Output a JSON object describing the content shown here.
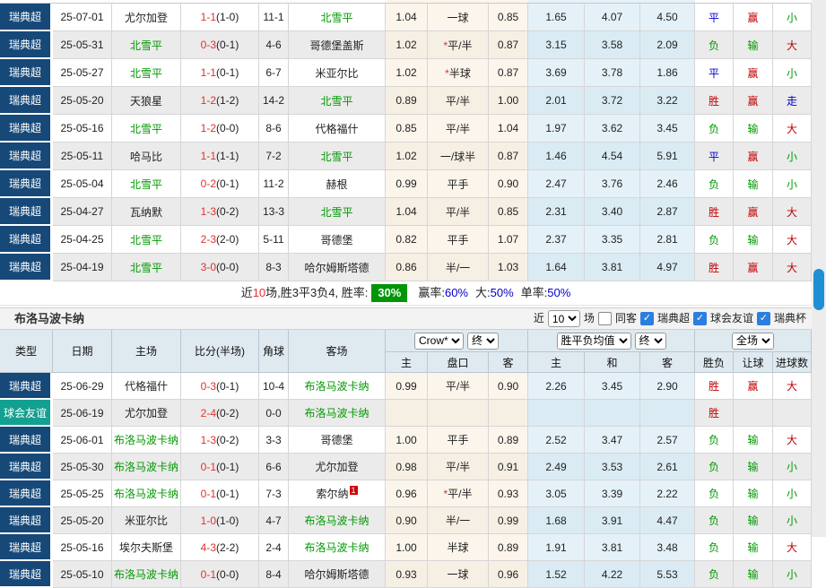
{
  "colors": {
    "league_navy": "#164878",
    "friendly_teal": "#14a091",
    "score_red": "#e03131",
    "word_red": "#c00000",
    "word_green": "#009900",
    "word_blue": "#0000cb",
    "asian_bg": "#fbf5ec",
    "euro_bg": "#e4f1f8",
    "alt_row": "#ebebeb",
    "summary_box_green": "#009608",
    "checkbox_blue": "#2b7fe0",
    "scroll_thumb": "#1f8fd6"
  },
  "icons": {
    "checkmark": "✓"
  },
  "table1": {
    "rows": [
      {
        "lg": "瑞典超",
        "date": "25-07-01",
        "home": "尤尔加登",
        "hg": false,
        "score": "1-1",
        "half": "(1-0)",
        "corner": "11-1",
        "away": "北雪平",
        "ag": true,
        "a1": "1.04",
        "star": false,
        "line": "一球",
        "a2": "0.85",
        "e1": "1.65",
        "e2": "4.07",
        "e3": "4.50",
        "r": "平",
        "rc": "blue",
        "h": "赢",
        "hc": "red",
        "g": "小",
        "gc": "green"
      },
      {
        "lg": "瑞典超",
        "date": "25-05-31",
        "home": "北雪平",
        "hg": true,
        "score": "0-3",
        "half": "(0-1)",
        "corner": "4-6",
        "away": "哥德堡盖斯",
        "ag": false,
        "a1": "1.02",
        "star": true,
        "line": "平/半",
        "a2": "0.87",
        "e1": "3.15",
        "e2": "3.58",
        "e3": "2.09",
        "r": "负",
        "rc": "green",
        "h": "输",
        "hc": "green",
        "g": "大",
        "gc": "red"
      },
      {
        "lg": "瑞典超",
        "date": "25-05-27",
        "home": "北雪平",
        "hg": true,
        "score": "1-1",
        "half": "(0-1)",
        "corner": "6-7",
        "away": "米亚尔比",
        "ag": false,
        "a1": "1.02",
        "star": true,
        "line": "半球",
        "a2": "0.87",
        "e1": "3.69",
        "e2": "3.78",
        "e3": "1.86",
        "r": "平",
        "rc": "blue",
        "h": "赢",
        "hc": "red",
        "g": "小",
        "gc": "green"
      },
      {
        "lg": "瑞典超",
        "date": "25-05-20",
        "home": "天狼星",
        "hg": false,
        "score": "1-2",
        "half": "(1-2)",
        "corner": "14-2",
        "away": "北雪平",
        "ag": true,
        "a1": "0.89",
        "star": false,
        "line": "平/半",
        "a2": "1.00",
        "e1": "2.01",
        "e2": "3.72",
        "e3": "3.22",
        "r": "胜",
        "rc": "red",
        "h": "赢",
        "hc": "red",
        "g": "走",
        "gc": "blue"
      },
      {
        "lg": "瑞典超",
        "date": "25-05-16",
        "home": "北雪平",
        "hg": true,
        "score": "1-2",
        "half": "(0-0)",
        "corner": "8-6",
        "away": "代格福什",
        "ag": false,
        "a1": "0.85",
        "star": false,
        "line": "平/半",
        "a2": "1.04",
        "e1": "1.97",
        "e2": "3.62",
        "e3": "3.45",
        "r": "负",
        "rc": "green",
        "h": "输",
        "hc": "green",
        "g": "大",
        "gc": "red"
      },
      {
        "lg": "瑞典超",
        "date": "25-05-11",
        "home": "哈马比",
        "hg": false,
        "score": "1-1",
        "half": "(1-1)",
        "corner": "7-2",
        "away": "北雪平",
        "ag": true,
        "a1": "1.02",
        "star": false,
        "line": "一/球半",
        "a2": "0.87",
        "e1": "1.46",
        "e2": "4.54",
        "e3": "5.91",
        "r": "平",
        "rc": "blue",
        "h": "赢",
        "hc": "red",
        "g": "小",
        "gc": "green"
      },
      {
        "lg": "瑞典超",
        "date": "25-05-04",
        "home": "北雪平",
        "hg": true,
        "score": "0-2",
        "half": "(0-1)",
        "corner": "11-2",
        "away": "赫根",
        "ag": false,
        "a1": "0.99",
        "star": false,
        "line": "平手",
        "a2": "0.90",
        "e1": "2.47",
        "e2": "3.76",
        "e3": "2.46",
        "r": "负",
        "rc": "green",
        "h": "输",
        "hc": "green",
        "g": "小",
        "gc": "green"
      },
      {
        "lg": "瑞典超",
        "date": "25-04-27",
        "home": "瓦纳默",
        "hg": false,
        "score": "1-3",
        "half": "(0-2)",
        "corner": "13-3",
        "away": "北雪平",
        "ag": true,
        "a1": "1.04",
        "star": false,
        "line": "平/半",
        "a2": "0.85",
        "e1": "2.31",
        "e2": "3.40",
        "e3": "2.87",
        "r": "胜",
        "rc": "red",
        "h": "赢",
        "hc": "red",
        "g": "大",
        "gc": "red"
      },
      {
        "lg": "瑞典超",
        "date": "25-04-25",
        "home": "北雪平",
        "hg": true,
        "score": "2-3",
        "half": "(2-0)",
        "corner": "5-11",
        "away": "哥德堡",
        "ag": false,
        "a1": "0.82",
        "star": false,
        "line": "平手",
        "a2": "1.07",
        "e1": "2.37",
        "e2": "3.35",
        "e3": "2.81",
        "r": "负",
        "rc": "green",
        "h": "输",
        "hc": "green",
        "g": "大",
        "gc": "red"
      },
      {
        "lg": "瑞典超",
        "date": "25-04-19",
        "home": "北雪平",
        "hg": true,
        "score": "3-0",
        "half": "(0-0)",
        "corner": "8-3",
        "away": "哈尔姆斯塔德",
        "ag": false,
        "a1": "0.86",
        "star": false,
        "line": "半/一",
        "a2": "1.03",
        "e1": "1.64",
        "e2": "3.81",
        "e3": "4.97",
        "r": "胜",
        "rc": "red",
        "h": "赢",
        "hc": "red",
        "g": "大",
        "gc": "red"
      }
    ],
    "summary": {
      "t1": "近",
      "t2": "10",
      "t3": "场,胜3平3负4, 胜率:",
      "box": "30%",
      "parts": [
        {
          "label": "赢率:",
          "value": "60%"
        },
        {
          "label": "大:",
          "value": "50%"
        },
        {
          "label": "单率:",
          "value": "50%"
        }
      ]
    }
  },
  "table2": {
    "title": "布洛马波卡纳",
    "controls": {
      "recent_label": "近",
      "recent_value": "10",
      "matches_label": "场",
      "same_venue_label": "同客",
      "leagues": [
        {
          "label": "瑞典超",
          "checked": true
        },
        {
          "label": "球会友谊",
          "checked": true
        },
        {
          "label": "瑞典杯",
          "checked": true
        }
      ]
    },
    "header": {
      "cols": [
        "类型",
        "日期",
        "主场",
        "比分(半场)",
        "角球",
        "客场"
      ],
      "sub": [
        "主",
        "盘口",
        "客",
        "主",
        "和",
        "客",
        "胜负",
        "让球",
        "进球数"
      ],
      "selects": {
        "crow": "Crow*",
        "final1": "终",
        "avg": "胜平负均值",
        "final2": "终",
        "scope": "全场"
      }
    },
    "rows": [
      {
        "lg": "瑞典超",
        "teal": false,
        "date": "25-06-29",
        "home": "代格福什",
        "hg": false,
        "score": "0-3",
        "half": "(0-1)",
        "corner": "10-4",
        "away": "布洛马波卡纳",
        "ag": true,
        "a1": "0.99",
        "star": false,
        "line": "平/半",
        "a2": "0.90",
        "e1": "2.26",
        "e2": "3.45",
        "e3": "2.90",
        "r": "胜",
        "rc": "red",
        "h": "赢",
        "hc": "red",
        "g": "大",
        "gc": "red"
      },
      {
        "lg": "球会友谊",
        "teal": true,
        "date": "25-06-19",
        "home": "尤尔加登",
        "hg": false,
        "score": "2-4",
        "half": "(0-2)",
        "corner": "0-0",
        "away": "布洛马波卡纳",
        "ag": true,
        "a1": "",
        "star": false,
        "line": "",
        "a2": "",
        "e1": "",
        "e2": "",
        "e3": "",
        "r": "胜",
        "rc": "red",
        "h": "",
        "hc": "red",
        "g": "",
        "gc": "red"
      },
      {
        "lg": "瑞典超",
        "teal": false,
        "date": "25-06-01",
        "home": "布洛马波卡纳",
        "hg": true,
        "score": "1-3",
        "half": "(0-2)",
        "corner": "3-3",
        "away": "哥德堡",
        "ag": false,
        "a1": "1.00",
        "star": false,
        "line": "平手",
        "a2": "0.89",
        "e1": "2.52",
        "e2": "3.47",
        "e3": "2.57",
        "r": "负",
        "rc": "green",
        "h": "输",
        "hc": "green",
        "g": "大",
        "gc": "red"
      },
      {
        "lg": "瑞典超",
        "teal": false,
        "date": "25-05-30",
        "home": "布洛马波卡纳",
        "hg": true,
        "score": "0-1",
        "half": "(0-1)",
        "corner": "6-6",
        "away": "尤尔加登",
        "ag": false,
        "a1": "0.98",
        "star": false,
        "line": "平/半",
        "a2": "0.91",
        "e1": "2.49",
        "e2": "3.53",
        "e3": "2.61",
        "r": "负",
        "rc": "green",
        "h": "输",
        "hc": "green",
        "g": "小",
        "gc": "green"
      },
      {
        "lg": "瑞典超",
        "teal": false,
        "date": "25-05-25",
        "home": "布洛马波卡纳",
        "hg": true,
        "score": "0-1",
        "half": "(0-1)",
        "corner": "7-3",
        "away": "索尔纳",
        "ag": false,
        "card": "1",
        "a1": "0.96",
        "star": true,
        "line": "平/半",
        "a2": "0.93",
        "e1": "3.05",
        "e2": "3.39",
        "e3": "2.22",
        "r": "负",
        "rc": "green",
        "h": "输",
        "hc": "green",
        "g": "小",
        "gc": "green"
      },
      {
        "lg": "瑞典超",
        "teal": false,
        "date": "25-05-20",
        "home": "米亚尔比",
        "hg": false,
        "score": "1-0",
        "half": "(1-0)",
        "corner": "4-7",
        "away": "布洛马波卡纳",
        "ag": true,
        "a1": "0.90",
        "star": false,
        "line": "半/一",
        "a2": "0.99",
        "e1": "1.68",
        "e2": "3.91",
        "e3": "4.47",
        "r": "负",
        "rc": "green",
        "h": "输",
        "hc": "green",
        "g": "小",
        "gc": "green"
      },
      {
        "lg": "瑞典超",
        "teal": false,
        "date": "25-05-16",
        "home": "埃尔夫斯堡",
        "hg": false,
        "score": "4-3",
        "half": "(2-2)",
        "corner": "2-4",
        "away": "布洛马波卡纳",
        "ag": true,
        "a1": "1.00",
        "star": false,
        "line": "半球",
        "a2": "0.89",
        "e1": "1.91",
        "e2": "3.81",
        "e3": "3.48",
        "r": "负",
        "rc": "green",
        "h": "输",
        "hc": "green",
        "g": "大",
        "gc": "red"
      },
      {
        "lg": "瑞典超",
        "teal": false,
        "date": "25-05-10",
        "home": "布洛马波卡纳",
        "hg": true,
        "score": "0-1",
        "half": "(0-0)",
        "corner": "8-4",
        "away": "哈尔姆斯塔德",
        "ag": false,
        "a1": "0.93",
        "star": false,
        "line": "一球",
        "a2": "0.96",
        "e1": "1.52",
        "e2": "4.22",
        "e3": "5.53",
        "r": "负",
        "rc": "green",
        "h": "输",
        "hc": "green",
        "g": "小",
        "gc": "green"
      }
    ]
  }
}
